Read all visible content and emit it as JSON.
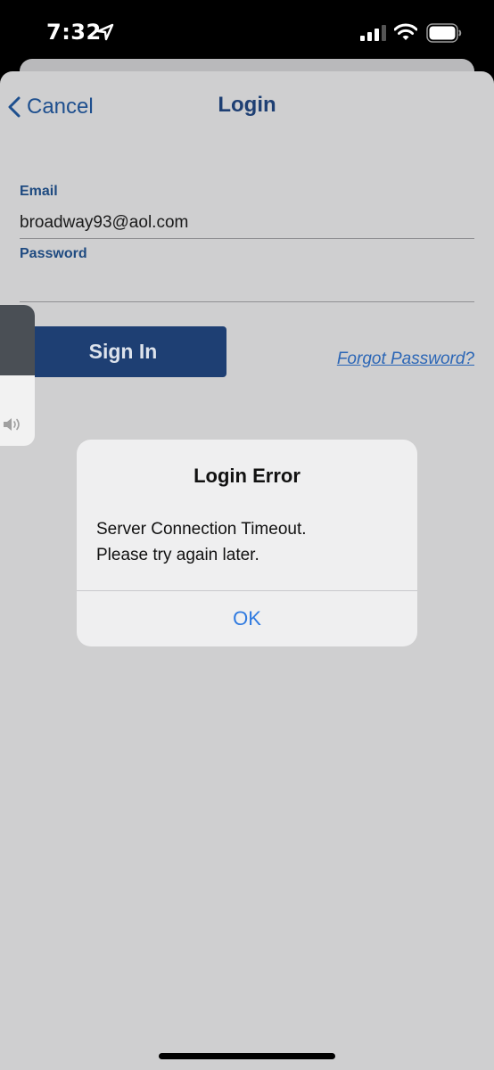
{
  "status_bar": {
    "time": "7:32",
    "icons": [
      "location-arrow-icon",
      "cellular-signal-icon",
      "wifi-icon",
      "battery-icon"
    ]
  },
  "nav": {
    "cancel_label": "Cancel",
    "title": "Login"
  },
  "form": {
    "email_label": "Email",
    "email_value": "broadway93@aol.com",
    "password_label": "Password",
    "password_value": "",
    "signin_label": "Sign In",
    "forgot_label": "Forgot Password?"
  },
  "volume": {
    "level": 0.5,
    "icon": "speaker-icon"
  },
  "alert": {
    "title": "Login Error",
    "message_line1": "Server Connection Timeout.",
    "message_line2": "Please try again later.",
    "ok_label": "OK"
  },
  "colors": {
    "primary": "#1e3f73",
    "link": "#2b66b6",
    "alert_button": "#2f7ae0",
    "background": "#cfcfd0"
  }
}
